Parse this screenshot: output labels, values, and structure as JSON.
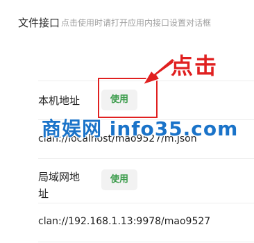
{
  "dialog": {
    "title": "文件接口",
    "hint": "点击使用时请打开应用内接口设置对话框"
  },
  "local": {
    "label": "本机地址",
    "use_button": "使用",
    "url": "clan://localhost/mao9527/m.json"
  },
  "lan": {
    "label_line1": "局域网地",
    "label_line2": "址",
    "use_button": "使用",
    "url": "clan://192.168.1.13:9978/mao9527"
  },
  "annotation": {
    "callout_text": "点击",
    "color": "#e02020"
  },
  "watermark": {
    "text": "商娱网 info35.com",
    "color": "#1a73c9"
  },
  "colors": {
    "accent_green": "#3a9b4a",
    "divider": "#ececec",
    "hint_gray": "#a0a0a0"
  }
}
